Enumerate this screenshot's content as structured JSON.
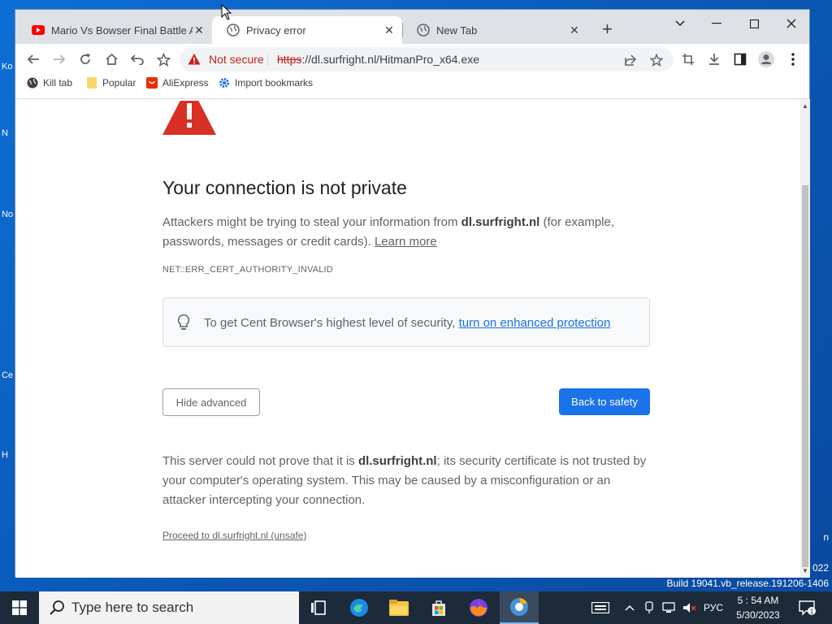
{
  "desktop": {
    "icon_fragments": [
      "Ko",
      "N",
      "No",
      "Ce",
      "H"
    ],
    "watermark_year": "022",
    "watermark_build": "Build 19041.vb_release.191206-1406",
    "edge_letter": "n"
  },
  "browser": {
    "tabs": [
      {
        "title": "Mario Vs Bowser Final Battle Am",
        "favicon": "youtube-icon",
        "active": false
      },
      {
        "title": "Privacy error",
        "favicon": "globe-icon",
        "active": true
      },
      {
        "title": "New Tab",
        "favicon": "globe-icon",
        "active": false
      }
    ],
    "omnibox": {
      "security_label": "Not secure",
      "url_scheme": "https",
      "url_rest": "://dl.surfright.nl/HitmanPro_x64.exe"
    },
    "bookmarks": [
      {
        "label": "Kill tab",
        "icon": "globe-dark-icon"
      },
      {
        "label": "Popular",
        "icon": "folder-icon"
      },
      {
        "label": "AliExpress",
        "icon": "aliexpress-icon"
      },
      {
        "label": "Import bookmarks",
        "icon": "gear-icon"
      }
    ]
  },
  "error_page": {
    "title": "Your connection is not private",
    "body_pre": "Attackers might be trying to steal your information from ",
    "body_domain": "dl.surfright.nl",
    "body_post": " (for example, passwords, messages or credit cards). ",
    "learn_more": "Learn more",
    "error_code": "NET::ERR_CERT_AUTHORITY_INVALID",
    "enhanced_text": "To get Cent Browser's highest level of security, ",
    "enhanced_link": "turn on enhanced protection",
    "hide_advanced": "Hide advanced",
    "back_to_safety": "Back to safety",
    "adv_pre": "This server could not prove that it is ",
    "adv_domain": "dl.surfright.nl",
    "adv_post": "; its security certificate is not trusted by your computer's operating system. This may be caused by a misconfiguration or an attacker intercepting your connection.",
    "proceed": "Proceed to dl.surfright.nl (unsafe)"
  },
  "taskbar": {
    "search_placeholder": "Type here to search",
    "language": "РУС",
    "time": "5 : 54 AM",
    "date": "5/30/2023",
    "notification_count": "1"
  },
  "colors": {
    "accent": "#1a73e8",
    "danger": "#c5221f",
    "warning_triangle": "#d93025"
  }
}
